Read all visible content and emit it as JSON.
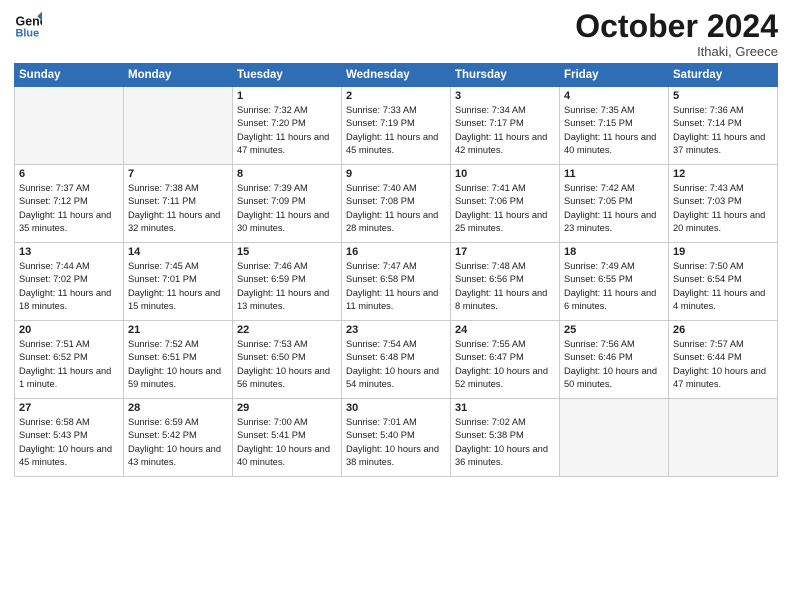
{
  "header": {
    "logo_line1": "General",
    "logo_line2": "Blue",
    "month": "October 2024",
    "location": "Ithaki, Greece"
  },
  "weekdays": [
    "Sunday",
    "Monday",
    "Tuesday",
    "Wednesday",
    "Thursday",
    "Friday",
    "Saturday"
  ],
  "weeks": [
    [
      {
        "day": "",
        "empty": true
      },
      {
        "day": "",
        "empty": true
      },
      {
        "day": "1",
        "sr": "7:32 AM",
        "ss": "7:20 PM",
        "dl": "11 hours and 47 minutes."
      },
      {
        "day": "2",
        "sr": "7:33 AM",
        "ss": "7:19 PM",
        "dl": "11 hours and 45 minutes."
      },
      {
        "day": "3",
        "sr": "7:34 AM",
        "ss": "7:17 PM",
        "dl": "11 hours and 42 minutes."
      },
      {
        "day": "4",
        "sr": "7:35 AM",
        "ss": "7:15 PM",
        "dl": "11 hours and 40 minutes."
      },
      {
        "day": "5",
        "sr": "7:36 AM",
        "ss": "7:14 PM",
        "dl": "11 hours and 37 minutes."
      }
    ],
    [
      {
        "day": "6",
        "sr": "7:37 AM",
        "ss": "7:12 PM",
        "dl": "11 hours and 35 minutes."
      },
      {
        "day": "7",
        "sr": "7:38 AM",
        "ss": "7:11 PM",
        "dl": "11 hours and 32 minutes."
      },
      {
        "day": "8",
        "sr": "7:39 AM",
        "ss": "7:09 PM",
        "dl": "11 hours and 30 minutes."
      },
      {
        "day": "9",
        "sr": "7:40 AM",
        "ss": "7:08 PM",
        "dl": "11 hours and 28 minutes."
      },
      {
        "day": "10",
        "sr": "7:41 AM",
        "ss": "7:06 PM",
        "dl": "11 hours and 25 minutes."
      },
      {
        "day": "11",
        "sr": "7:42 AM",
        "ss": "7:05 PM",
        "dl": "11 hours and 23 minutes."
      },
      {
        "day": "12",
        "sr": "7:43 AM",
        "ss": "7:03 PM",
        "dl": "11 hours and 20 minutes."
      }
    ],
    [
      {
        "day": "13",
        "sr": "7:44 AM",
        "ss": "7:02 PM",
        "dl": "11 hours and 18 minutes."
      },
      {
        "day": "14",
        "sr": "7:45 AM",
        "ss": "7:01 PM",
        "dl": "11 hours and 15 minutes."
      },
      {
        "day": "15",
        "sr": "7:46 AM",
        "ss": "6:59 PM",
        "dl": "11 hours and 13 minutes."
      },
      {
        "day": "16",
        "sr": "7:47 AM",
        "ss": "6:58 PM",
        "dl": "11 hours and 11 minutes."
      },
      {
        "day": "17",
        "sr": "7:48 AM",
        "ss": "6:56 PM",
        "dl": "11 hours and 8 minutes."
      },
      {
        "day": "18",
        "sr": "7:49 AM",
        "ss": "6:55 PM",
        "dl": "11 hours and 6 minutes."
      },
      {
        "day": "19",
        "sr": "7:50 AM",
        "ss": "6:54 PM",
        "dl": "11 hours and 4 minutes."
      }
    ],
    [
      {
        "day": "20",
        "sr": "7:51 AM",
        "ss": "6:52 PM",
        "dl": "11 hours and 1 minute."
      },
      {
        "day": "21",
        "sr": "7:52 AM",
        "ss": "6:51 PM",
        "dl": "10 hours and 59 minutes."
      },
      {
        "day": "22",
        "sr": "7:53 AM",
        "ss": "6:50 PM",
        "dl": "10 hours and 56 minutes."
      },
      {
        "day": "23",
        "sr": "7:54 AM",
        "ss": "6:48 PM",
        "dl": "10 hours and 54 minutes."
      },
      {
        "day": "24",
        "sr": "7:55 AM",
        "ss": "6:47 PM",
        "dl": "10 hours and 52 minutes."
      },
      {
        "day": "25",
        "sr": "7:56 AM",
        "ss": "6:46 PM",
        "dl": "10 hours and 50 minutes."
      },
      {
        "day": "26",
        "sr": "7:57 AM",
        "ss": "6:44 PM",
        "dl": "10 hours and 47 minutes."
      }
    ],
    [
      {
        "day": "27",
        "sr": "6:58 AM",
        "ss": "5:43 PM",
        "dl": "10 hours and 45 minutes."
      },
      {
        "day": "28",
        "sr": "6:59 AM",
        "ss": "5:42 PM",
        "dl": "10 hours and 43 minutes."
      },
      {
        "day": "29",
        "sr": "7:00 AM",
        "ss": "5:41 PM",
        "dl": "10 hours and 40 minutes."
      },
      {
        "day": "30",
        "sr": "7:01 AM",
        "ss": "5:40 PM",
        "dl": "10 hours and 38 minutes."
      },
      {
        "day": "31",
        "sr": "7:02 AM",
        "ss": "5:38 PM",
        "dl": "10 hours and 36 minutes."
      },
      {
        "day": "",
        "empty": true
      },
      {
        "day": "",
        "empty": true
      }
    ]
  ],
  "labels": {
    "sunrise": "Sunrise:",
    "sunset": "Sunset:",
    "daylight": "Daylight:"
  }
}
